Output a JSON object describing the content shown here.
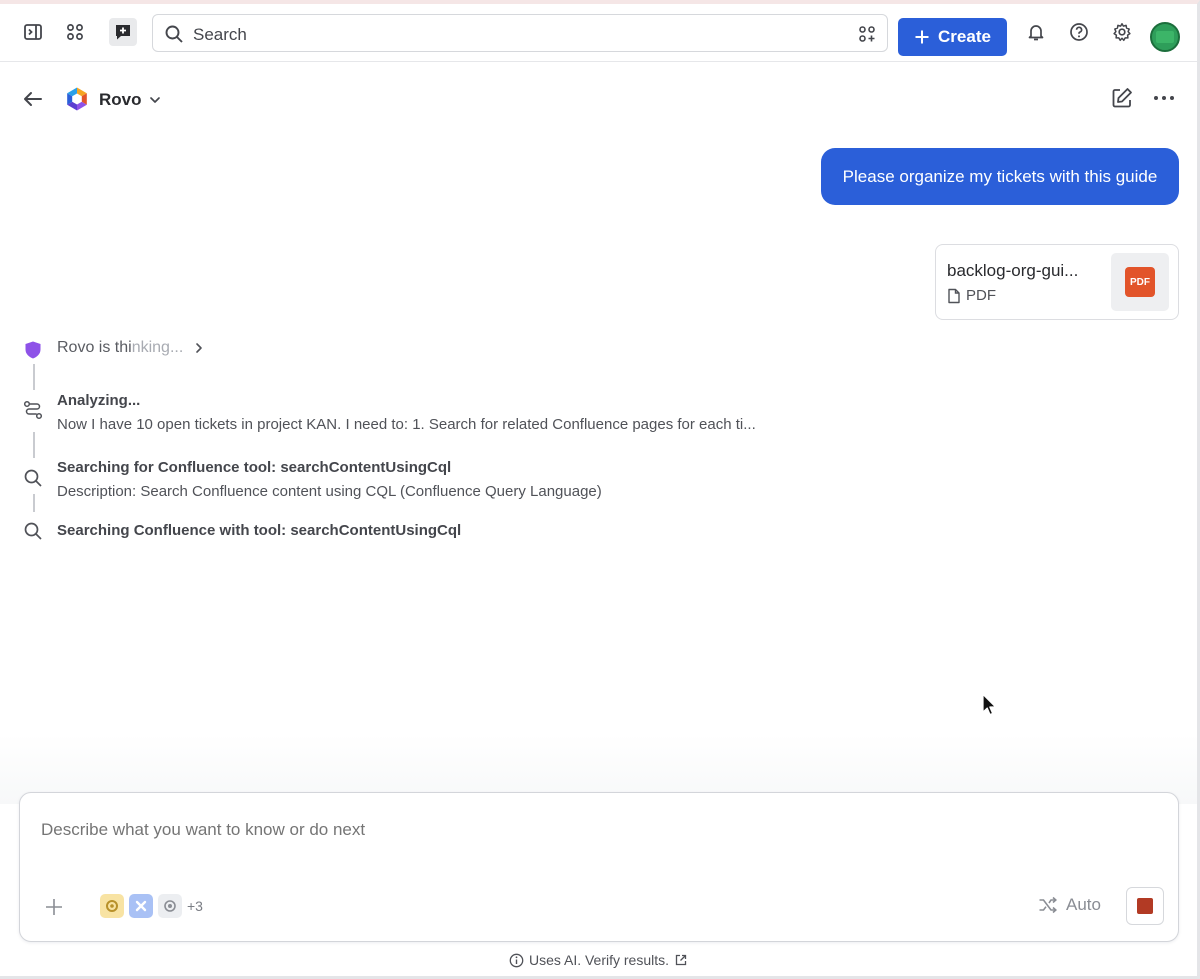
{
  "topbar": {
    "search_placeholder": "Search",
    "create_label": "Create",
    "icons": [
      "sidebar-toggle-icon",
      "app-switcher-icon",
      "rovo-chat-icon",
      "search-icon",
      "apps-add-icon",
      "bell-icon",
      "help-icon",
      "gear-icon",
      "avatar"
    ]
  },
  "header": {
    "agent_name": "Rovo"
  },
  "conversation": {
    "user_message": "Please organize my tickets with this guide",
    "attachment": {
      "file_name": "backlog-org-gui...",
      "file_type": "PDF",
      "thumb_label": "PDF"
    }
  },
  "thinking": {
    "status_prefix": "Rovo is thi",
    "status_suffix": "nking...",
    "steps": [
      {
        "icon": "analyze-icon",
        "title": "Analyzing...",
        "description": "Now I have 10 open tickets in project KAN. I need to: 1. Search for related Confluence pages for each ti..."
      },
      {
        "icon": "search-icon",
        "title": "Searching for Confluence tool: searchContentUsingCql",
        "description": "Description: Search Confluence content using CQL (Confluence Query Language)"
      },
      {
        "icon": "search-icon",
        "title": "Searching Confluence with tool: searchContentUsingCql",
        "description": ""
      }
    ]
  },
  "composer": {
    "placeholder": "Describe what you want to know or do next",
    "more_tools": "+3",
    "mode_label": "Auto",
    "colors": {
      "chip1": "#f8e3a3",
      "chip2": "#a9c1f5",
      "chip3": "#eceef1",
      "stop": "#b23a24"
    }
  },
  "footer": {
    "note": "Uses AI. Verify results."
  },
  "colors": {
    "accent": "#2b5fd9",
    "rovo_purple": "#8e52e8"
  }
}
